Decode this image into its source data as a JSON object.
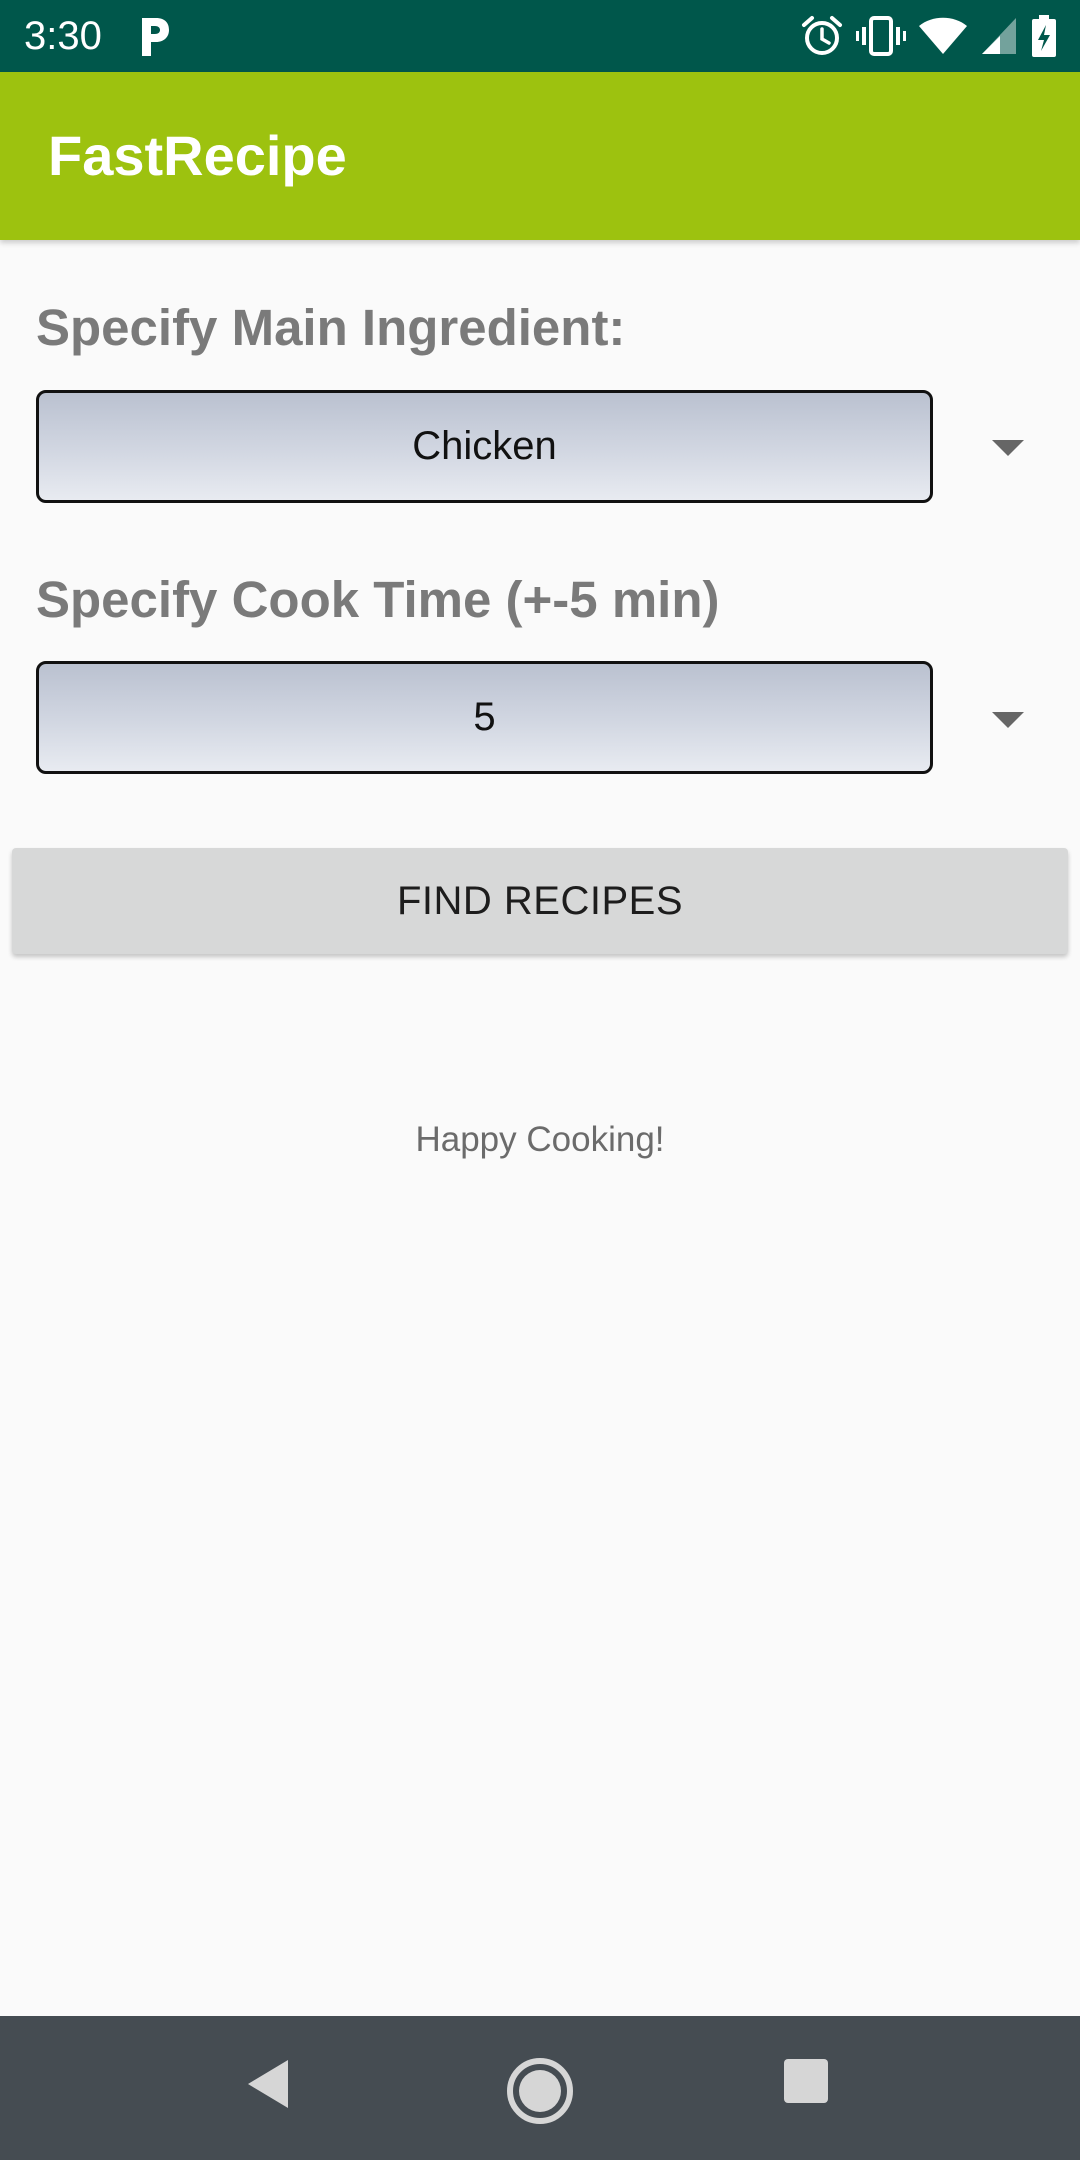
{
  "status_bar": {
    "time": "3:30",
    "background_color": "#00574b",
    "icons": [
      "parking-app-icon",
      "alarm-icon",
      "vibrate-icon",
      "wifi-icon",
      "cell-signal-icon",
      "battery-charging-icon"
    ]
  },
  "app_bar": {
    "title": "FastRecipe",
    "background_color": "#9dc20f"
  },
  "form": {
    "ingredient_label": "Specify Main Ingredient:",
    "ingredient_value": "Chicken",
    "cooktime_label": "Specify Cook Time (+-5 min)",
    "cooktime_value": "5",
    "find_button_label": "FIND RECIPES"
  },
  "footer_message": "Happy Cooking!",
  "nav_bar": {
    "background_color": "#454c52",
    "icons": [
      "back-icon",
      "home-icon",
      "recents-icon"
    ]
  }
}
